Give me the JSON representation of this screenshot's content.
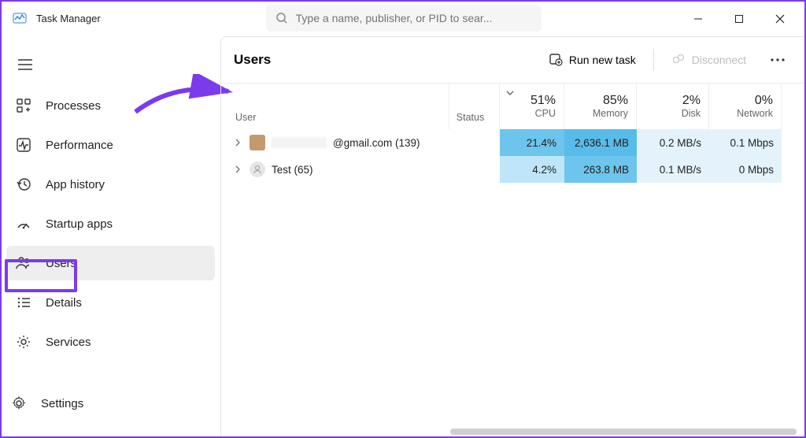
{
  "app": {
    "title": "Task Manager"
  },
  "search": {
    "placeholder": "Type a name, publisher, or PID to sear..."
  },
  "sidebar": {
    "items": [
      {
        "label": "Processes"
      },
      {
        "label": "Performance"
      },
      {
        "label": "App history"
      },
      {
        "label": "Startup apps"
      },
      {
        "label": "Users"
      },
      {
        "label": "Details"
      },
      {
        "label": "Services"
      }
    ],
    "settings_label": "Settings",
    "active_index": 4
  },
  "page": {
    "title": "Users",
    "actions": {
      "run_new_task": "Run new task",
      "disconnect": "Disconnect"
    }
  },
  "table": {
    "headers": {
      "user": "User",
      "status": "Status",
      "cpu": "CPU",
      "memory": "Memory",
      "disk": "Disk",
      "network": "Network"
    },
    "summary": {
      "cpu": "51%",
      "memory": "85%",
      "disk": "2%",
      "network": "0%"
    },
    "rows": [
      {
        "user_suffix": "@gmail.com (139)",
        "cpu": "21.4%",
        "memory": "2,636.1 MB",
        "disk": "0.2 MB/s",
        "network": "0.1 Mbps"
      },
      {
        "user_label": "Test (65)",
        "cpu": "4.2%",
        "memory": "263.8 MB",
        "disk": "0.1 MB/s",
        "network": "0 Mbps"
      }
    ]
  }
}
